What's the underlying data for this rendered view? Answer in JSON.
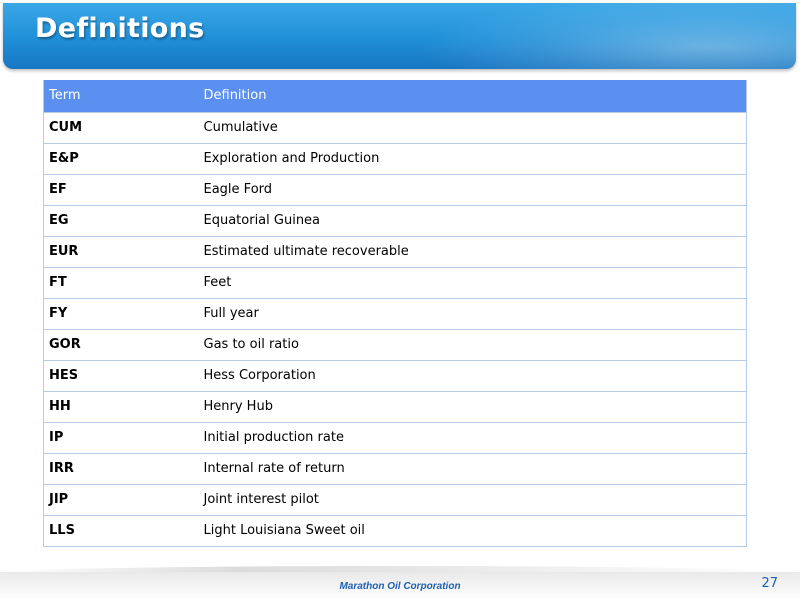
{
  "slide": {
    "title": "Definitions",
    "company": "Marathon Oil Corporation",
    "page_number": "27"
  },
  "table": {
    "headers": [
      "Term",
      "Definition"
    ],
    "rows": [
      {
        "term": "CUM",
        "definition": "Cumulative"
      },
      {
        "term": "E&P",
        "definition": "Exploration and Production"
      },
      {
        "term": "EF",
        "definition": "Eagle Ford"
      },
      {
        "term": "EG",
        "definition": "Equatorial Guinea"
      },
      {
        "term": "EUR",
        "definition": "Estimated ultimate recoverable"
      },
      {
        "term": "FT",
        "definition": "Feet"
      },
      {
        "term": "FY",
        "definition": "Full year"
      },
      {
        "term": "GOR",
        "definition": "Gas to oil ratio"
      },
      {
        "term": "HES",
        "definition": "Hess Corporation"
      },
      {
        "term": "HH",
        "definition": "Henry Hub"
      },
      {
        "term": "IP",
        "definition": "Initial production rate"
      },
      {
        "term": "IRR",
        "definition": "Internal rate of return"
      },
      {
        "term": "JIP",
        "definition": "Joint interest pilot"
      },
      {
        "term": "LLS",
        "definition": "Light Louisiana Sweet oil"
      }
    ]
  },
  "colors": {
    "header_blue": "#1f8fd8",
    "table_header": "#5b8ff0",
    "footer_text": "#1f5fb0"
  }
}
